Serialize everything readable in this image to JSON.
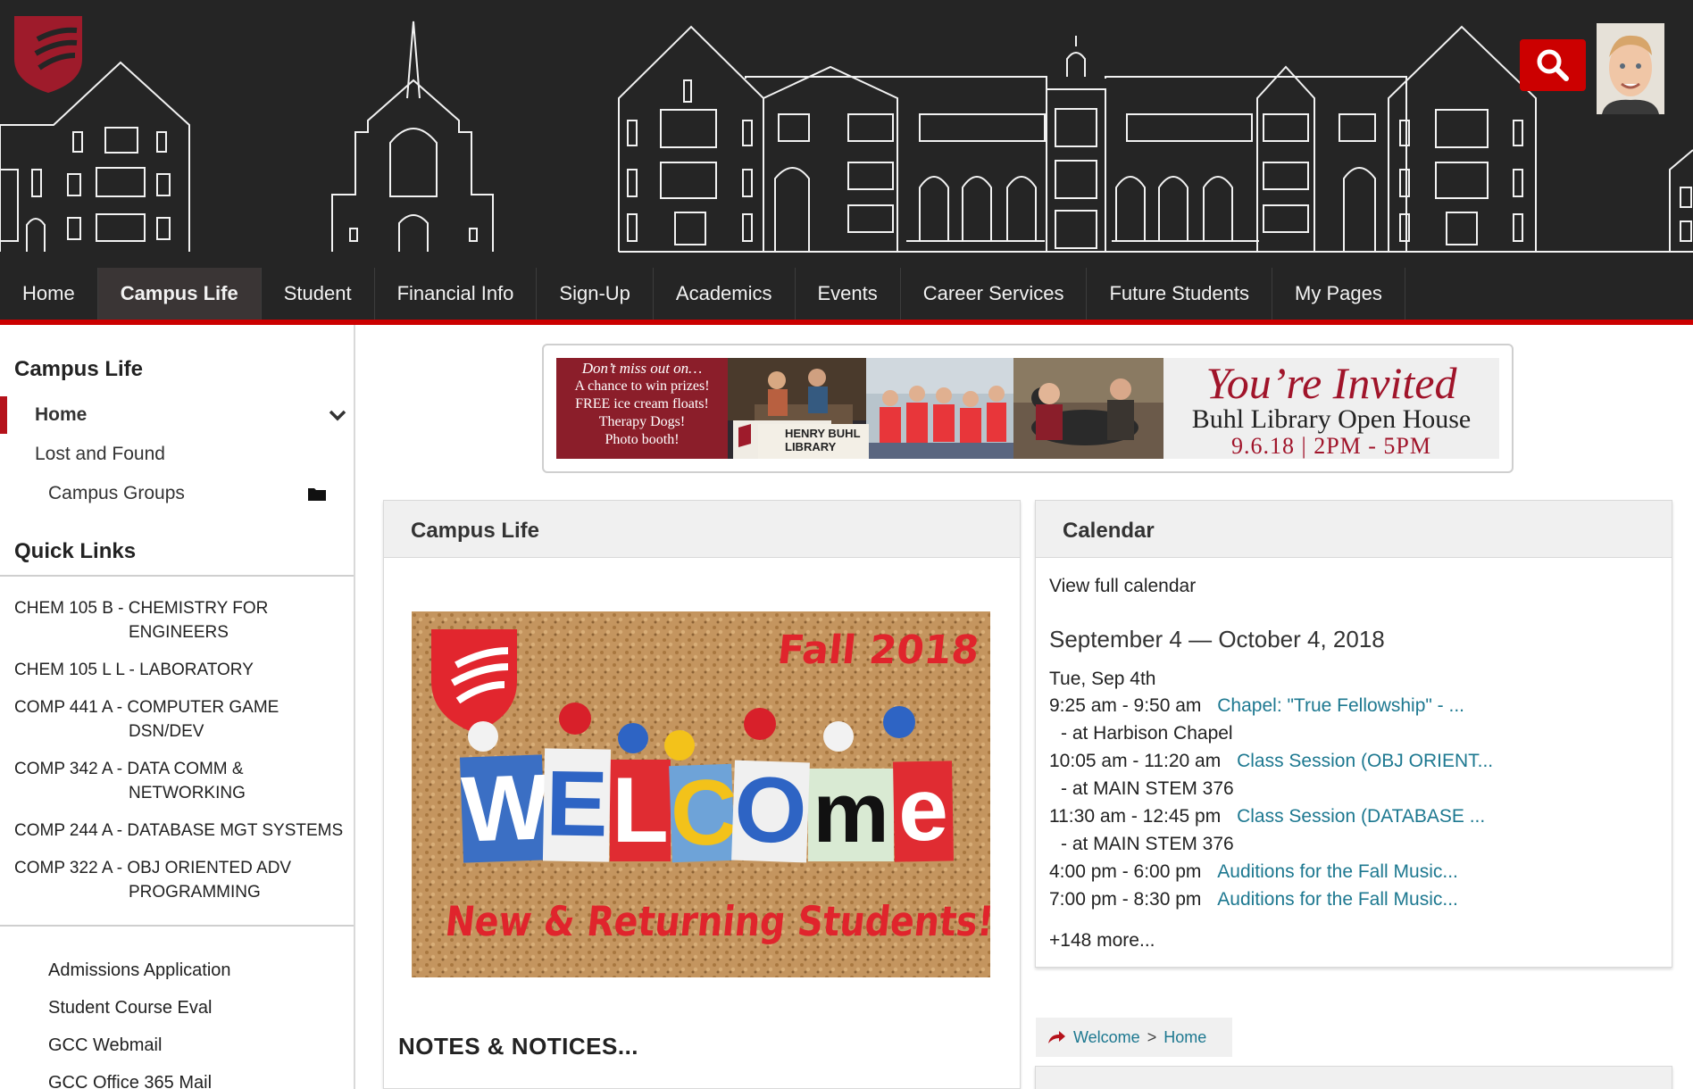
{
  "nav": {
    "items": [
      {
        "label": "Home"
      },
      {
        "label": "Campus Life"
      },
      {
        "label": "Student"
      },
      {
        "label": "Financial Info"
      },
      {
        "label": "Sign-Up"
      },
      {
        "label": "Academics"
      },
      {
        "label": "Events"
      },
      {
        "label": "Career Services"
      },
      {
        "label": "Future Students"
      },
      {
        "label": "My Pages"
      }
    ],
    "active": "Campus Life"
  },
  "sidebar": {
    "section_title": "Campus Life",
    "items": [
      {
        "label": "Home"
      },
      {
        "label": "Lost and Found"
      },
      {
        "label": "Campus Groups"
      }
    ],
    "quick_links_title": "Quick Links",
    "courses": [
      {
        "code": "CHEM 105 B -",
        "name": "CHEMISTRY FOR ENGINEERS"
      },
      {
        "code": "CHEM 105 L L -",
        "name": "LABORATORY"
      },
      {
        "code": "COMP 441 A -",
        "name": "COMPUTER GAME DSN/DEV"
      },
      {
        "code": "COMP 342 A -",
        "name": "DATA COMM & NETWORKING"
      },
      {
        "code": "COMP 244 A -",
        "name": "DATABASE MGT SYSTEMS"
      },
      {
        "code": "COMP 322 A -",
        "name": "OBJ ORIENTED ADV PROGRAMMING"
      }
    ],
    "links": [
      {
        "label": "Admissions Application"
      },
      {
        "label": "Student Course Eval"
      },
      {
        "label": "GCC Webmail"
      },
      {
        "label": "GCC Office 365 Mail"
      }
    ]
  },
  "banner": {
    "promo_lines": [
      "Don’t miss out on…",
      "A chance to win prizes!",
      "FREE ice cream floats!",
      "Therapy Dogs!",
      "Photo booth!"
    ],
    "library_sign": "HENRY BUHL LIBRARY",
    "invite_title": "You’re Invited",
    "invite_subtitle": "Buhl Library Open House",
    "invite_when": "9.6.18 | 2PM - 5PM"
  },
  "campus_panel": {
    "title": "Campus Life",
    "image": {
      "heading": "Fall 2018",
      "letters": [
        "W",
        "E",
        "L",
        "C",
        "O",
        "m",
        "e"
      ],
      "footer": "New & Returning Students!"
    },
    "notes_title": "NOTES & NOTICES..."
  },
  "calendar": {
    "title": "Calendar",
    "view_full": "View full calendar",
    "range": "September 4 — October 4, 2018",
    "day": "Tue, Sep 4th",
    "events": [
      {
        "time": "9:25 am - 9:50 am",
        "title": "Chapel: \"True Fellowship\" - ...",
        "location": "- at Harbison Chapel"
      },
      {
        "time": "10:05 am - 11:20 am",
        "title": "Class Session (OBJ ORIENT...",
        "location": "- at MAIN STEM 376"
      },
      {
        "time": "11:30 am - 12:45 pm",
        "title": "Class Session (DATABASE ...",
        "location": "- at MAIN STEM 376"
      },
      {
        "time": "4:00 pm - 6:00 pm",
        "title": "Auditions for the Fall Music..."
      },
      {
        "time": "7:00 pm - 8:30 pm",
        "title": "Auditions for the Fall Music..."
      }
    ],
    "more": "+148 more..."
  },
  "breadcrumb": {
    "items": [
      "Welcome",
      "Home"
    ],
    "separator": ">"
  },
  "colors": {
    "brand_red": "#cc0000",
    "header_bg": "#252525",
    "link_teal": "#1d7890"
  },
  "icons": [
    "shield-logo-icon",
    "search-icon",
    "chevron-down-icon",
    "folder-icon",
    "breadcrumb-arrow-icon"
  ]
}
